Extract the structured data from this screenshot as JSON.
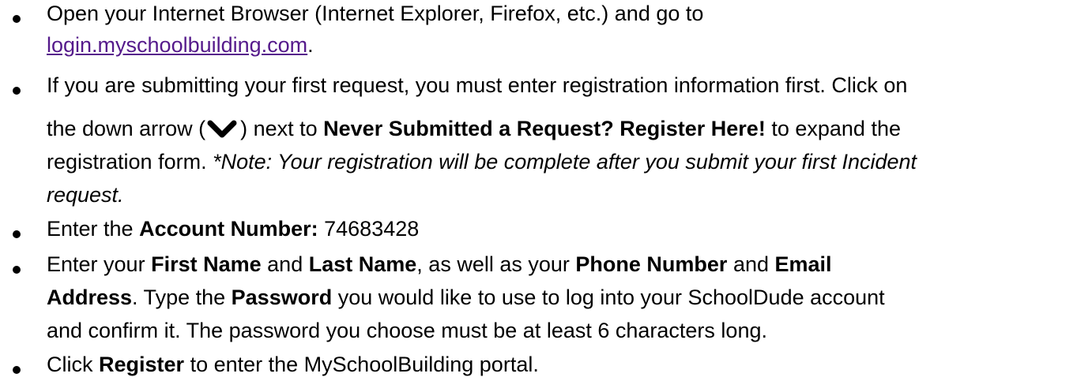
{
  "steps": [
    {
      "line1": "Open your Internet Browser (Internet Explorer, Firefox, etc.) and go to",
      "link": "login.myschoolbuilding.com",
      "after_link": "."
    },
    {
      "line1": "If you are submitting your first request, you must enter registration information first. Click on",
      "line2_a": "the down arrow (",
      "line2_b": ") next to",
      "line2_bold": "Never Submitted a Request? Register Here!",
      "line2_c": "to expand the",
      "line3_a": "registration form.",
      "line3_note": "*Note: Your registration will be complete after you submit your first Incident",
      "line4_note": "request."
    },
    {
      "text_a": "Enter the",
      "bold": "Account Number:",
      "value": "74683428"
    },
    {
      "a": "Enter your",
      "b1": "First Name",
      "c": "and",
      "b2": "Last Name",
      "d": ", as well as your",
      "b3": "Phone Number",
      "e": "and",
      "b4": "Email",
      "b5": "Address",
      "f": ". Type the",
      "b6": "Password",
      "g": "you would like to use to log into your SchoolDude account",
      "h": "and confirm it. The password you choose must be at least 6 characters long."
    },
    {
      "a": "Click",
      "bold": "Register",
      "b": "to enter the MySchoolBuilding portal."
    }
  ],
  "icons": {
    "down_arrow": "chevron-down-icon"
  }
}
